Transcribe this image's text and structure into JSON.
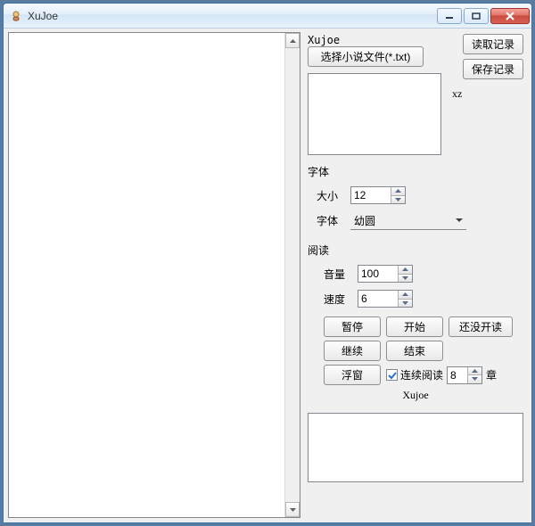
{
  "window": {
    "title": "XuJoe"
  },
  "header": {
    "label": "Xujoe"
  },
  "buttons": {
    "select_file": "选择小说文件(*.txt)",
    "read_record": "读取记录",
    "save_record": "保存记录",
    "pause": "暂停",
    "start": "开始",
    "not_yet_read": "还没开读",
    "continue": "继续",
    "end": "结束",
    "float_window": "浮窗"
  },
  "labels": {
    "xz": "xz",
    "font_section": "字体",
    "size": "大小",
    "font": "字体",
    "read_section": "阅读",
    "volume": "音量",
    "speed": "速度",
    "continuous": "连续阅读",
    "chapter_unit": "章",
    "footer": "Xujoe"
  },
  "values": {
    "font_size": "12",
    "font_name": "幼圆",
    "volume": "100",
    "speed": "6",
    "continuous_checked": true,
    "continuous_chapters": "8"
  }
}
